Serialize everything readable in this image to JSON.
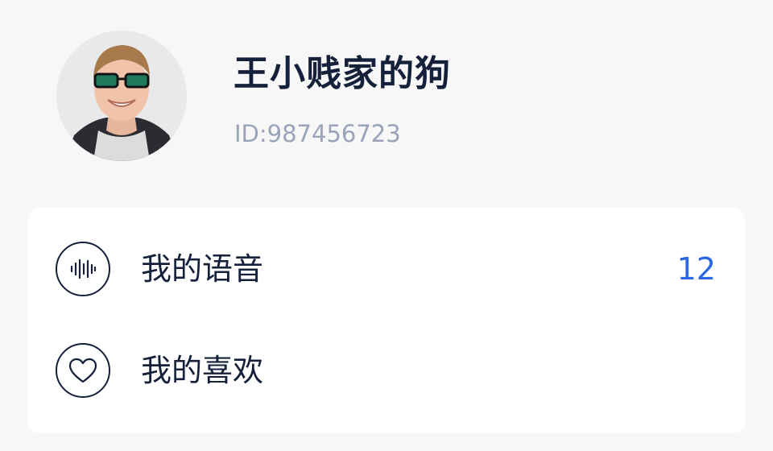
{
  "profile": {
    "name": "王小贱家的狗",
    "id_text": "ID:987456723"
  },
  "menu": {
    "items": [
      {
        "label": "我的语音",
        "count": "12",
        "icon": "voice-wave-icon"
      },
      {
        "label": "我的喜欢",
        "count": "",
        "icon": "heart-icon"
      }
    ]
  },
  "colors": {
    "text_primary": "#15203a",
    "text_secondary": "#9aa3b7",
    "accent": "#2b68e8",
    "background": "#f7f7f8",
    "card": "#ffffff"
  }
}
